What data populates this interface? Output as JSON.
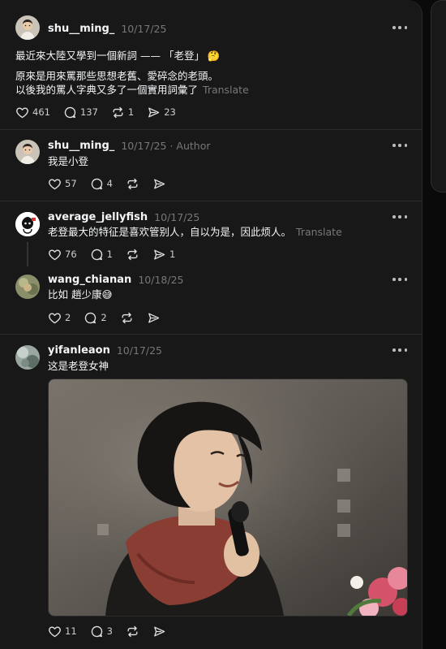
{
  "posts": [
    {
      "username": "shu__ming_",
      "time": "10/17/25",
      "line1": "最近來大陸又學到一個新詞 —— 「老登」 🤔",
      "line2": "原來是用來罵那些思想老舊、愛碎念的老頭。",
      "line3": "以後我的罵人字典又多了一個實用詞彙了",
      "translate": "Translate",
      "likes": "461",
      "replies": "137",
      "reposts": "1",
      "shares": "23"
    },
    {
      "username": "shu__ming_",
      "time": "10/17/25",
      "author_tag": "· Author",
      "text": "我是小登",
      "likes": "57",
      "replies": "4"
    },
    {
      "username": "average_jellyfish",
      "time": "10/17/25",
      "text": "老登最大的特征是喜欢管别人，自以为是，因此烦人。",
      "translate": "Translate",
      "likes": "76",
      "replies": "1",
      "shares": "1"
    },
    {
      "username": "wang_chianan",
      "time": "10/18/25",
      "text": "比如 趙少康😅",
      "likes": "2",
      "replies": "2"
    },
    {
      "username": "yifanleaon",
      "time": "10/17/25",
      "text": "这是老登女神",
      "likes": "11",
      "replies": "3"
    }
  ],
  "icons": {
    "like": "heart-icon",
    "reply": "comment-icon",
    "repost": "repost-icon",
    "share": "send-icon",
    "more": "more-horizontal-icon"
  },
  "colors": {
    "background": "#181818",
    "muted_text": "#777777",
    "primary_text": "#f3f5f7",
    "divider": "#2d2d2d"
  }
}
